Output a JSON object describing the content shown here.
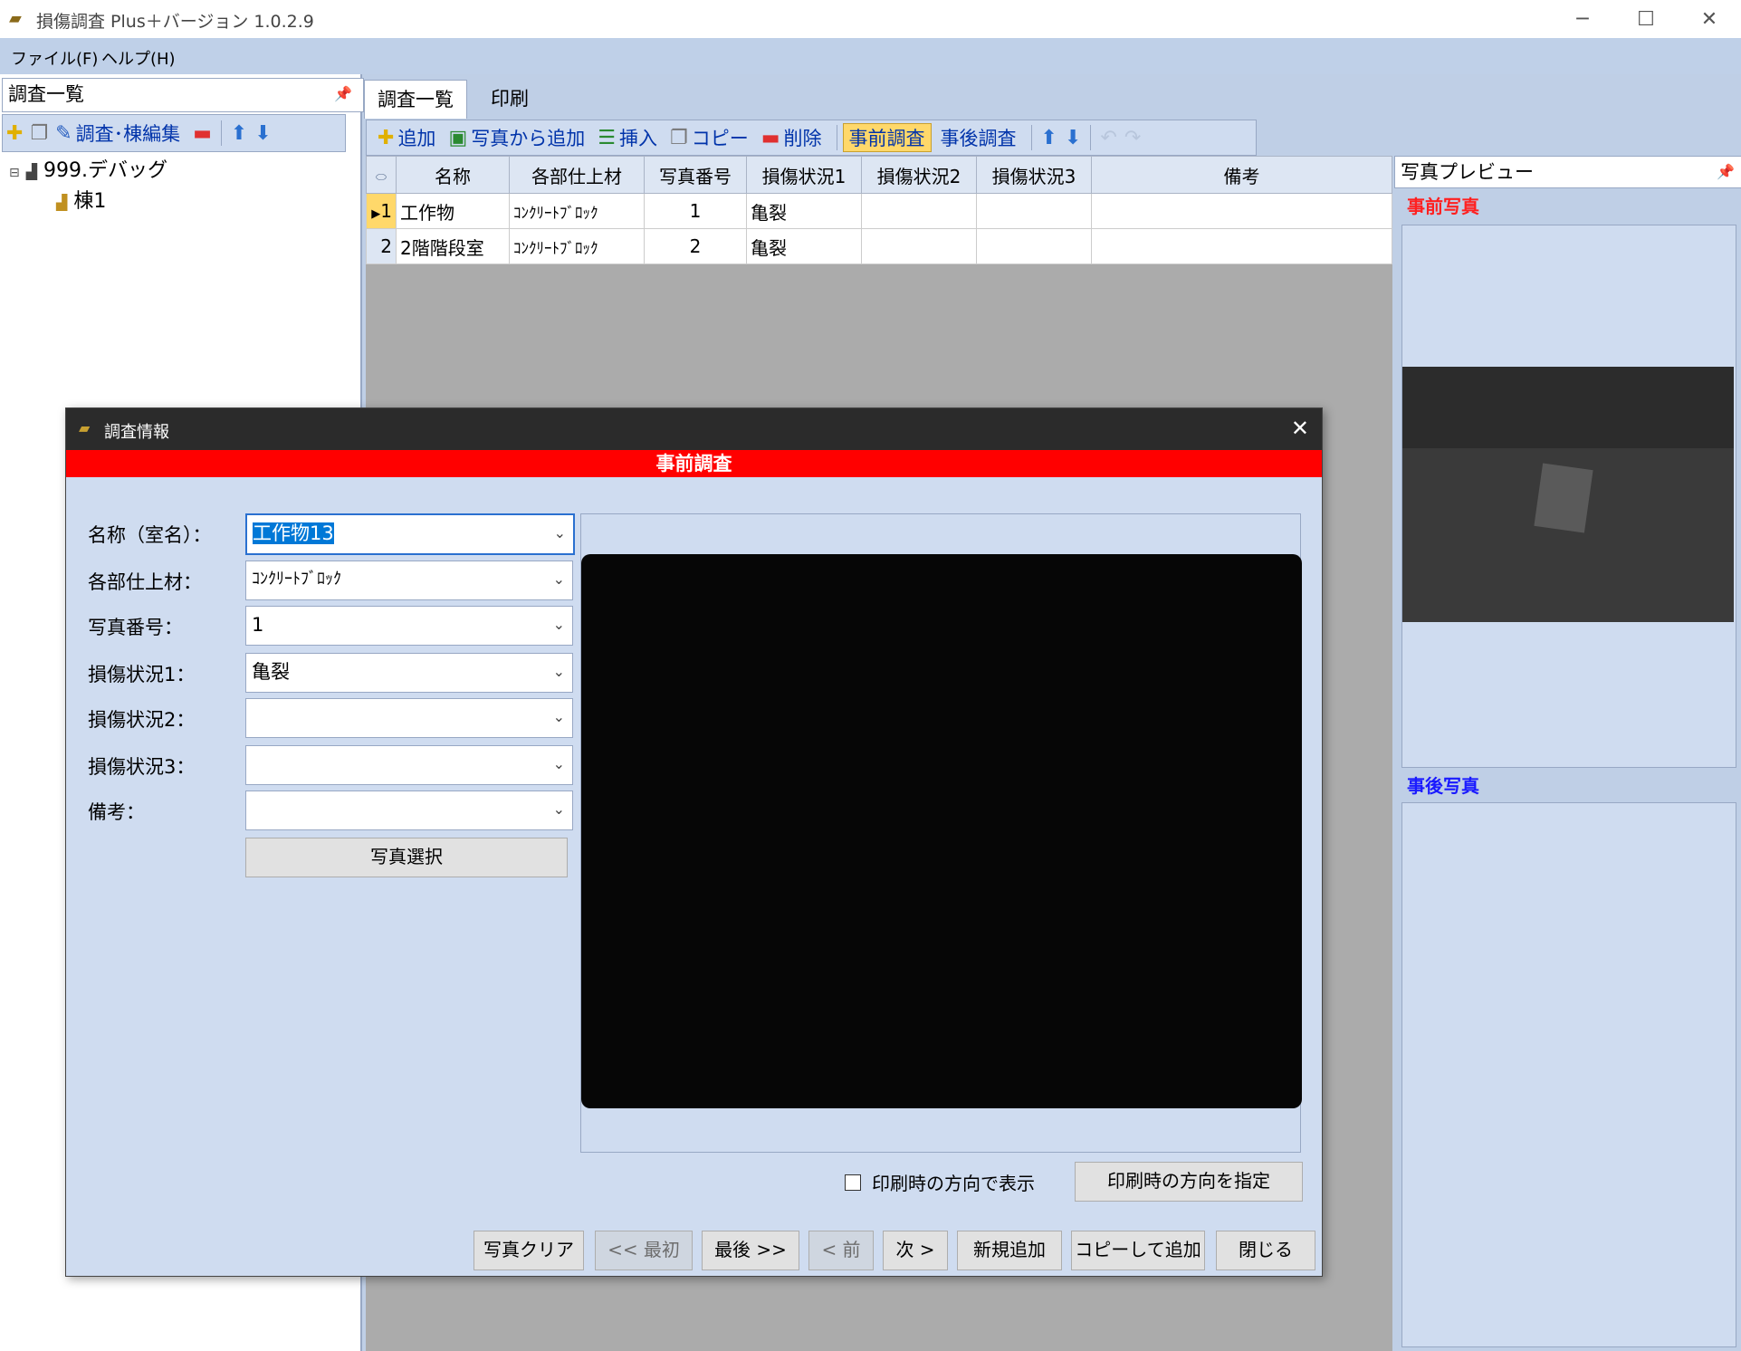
{
  "window": {
    "title": "損傷調査 Plus＋バージョン 1.0.2.9",
    "controls": [
      "─",
      "☐",
      "✕"
    ]
  },
  "menu": [
    "ファイル(F)",
    "ヘルプ(H)"
  ],
  "left_pane": {
    "header": "調査一覧",
    "toolbar_edit_label": "調査･棟編集",
    "tree": {
      "root": "999.デバッグ",
      "child": "棟1"
    }
  },
  "tabs": [
    "調査一覧",
    "印刷"
  ],
  "main_toolbar": {
    "add": "追加",
    "add_from_photo": "写真から追加",
    "insert": "挿入",
    "copy": "コピー",
    "delete": "削除",
    "pre_survey": "事前調査",
    "post_survey": "事後調査"
  },
  "grid": {
    "columns": [
      "名称",
      "各部仕上材",
      "写真番号",
      "損傷状況1",
      "損傷状況2",
      "損傷状況3",
      "備考"
    ],
    "rows": [
      {
        "no": "1",
        "name": "工作物",
        "material": "ｺﾝｸﾘｰﾄﾌﾞﾛｯｸ",
        "photo": "1",
        "d1": "亀裂",
        "d2": "",
        "d3": "",
        "note": ""
      },
      {
        "no": "2",
        "name": "2階階段室",
        "material": "ｺﾝｸﾘｰﾄﾌﾞﾛｯｸ",
        "photo": "2",
        "d1": "亀裂",
        "d2": "",
        "d3": "",
        "note": ""
      }
    ]
  },
  "preview_pane": {
    "header": "写真プレビュー",
    "before_label": "事前写真",
    "after_label": "事後写真",
    "before_color": "#ff2020",
    "after_color": "#1a1aff"
  },
  "dialog": {
    "title": "調査情報",
    "banner": "事前調査",
    "fields": {
      "name_label": "名称（室名）：",
      "name_value": "工作物13",
      "material_label": "各部仕上材：",
      "material_value": "ｺﾝｸﾘｰﾄﾌﾞﾛｯｸ",
      "photo_no_label": "写真番号：",
      "photo_no_value": "1",
      "damage1_label": "損傷状況1：",
      "damage1_value": "亀裂",
      "damage2_label": "損傷状況2：",
      "damage2_value": "",
      "damage3_label": "損傷状況3：",
      "damage3_value": "",
      "note_label": "備考：",
      "note_value": ""
    },
    "select_photo": "写真選択",
    "orientation_checkbox": "印刷時の方向で表示",
    "orientation_checked": false,
    "set_orientation": "印刷時の方向を指定",
    "buttons": {
      "clear_photo": "写真クリア",
      "first": "<< 最初",
      "last": "最後 >>",
      "prev": "< 前",
      "next": "次 >",
      "new": "新規追加",
      "copy_add": "コピーして追加",
      "close": "閉じる"
    }
  }
}
